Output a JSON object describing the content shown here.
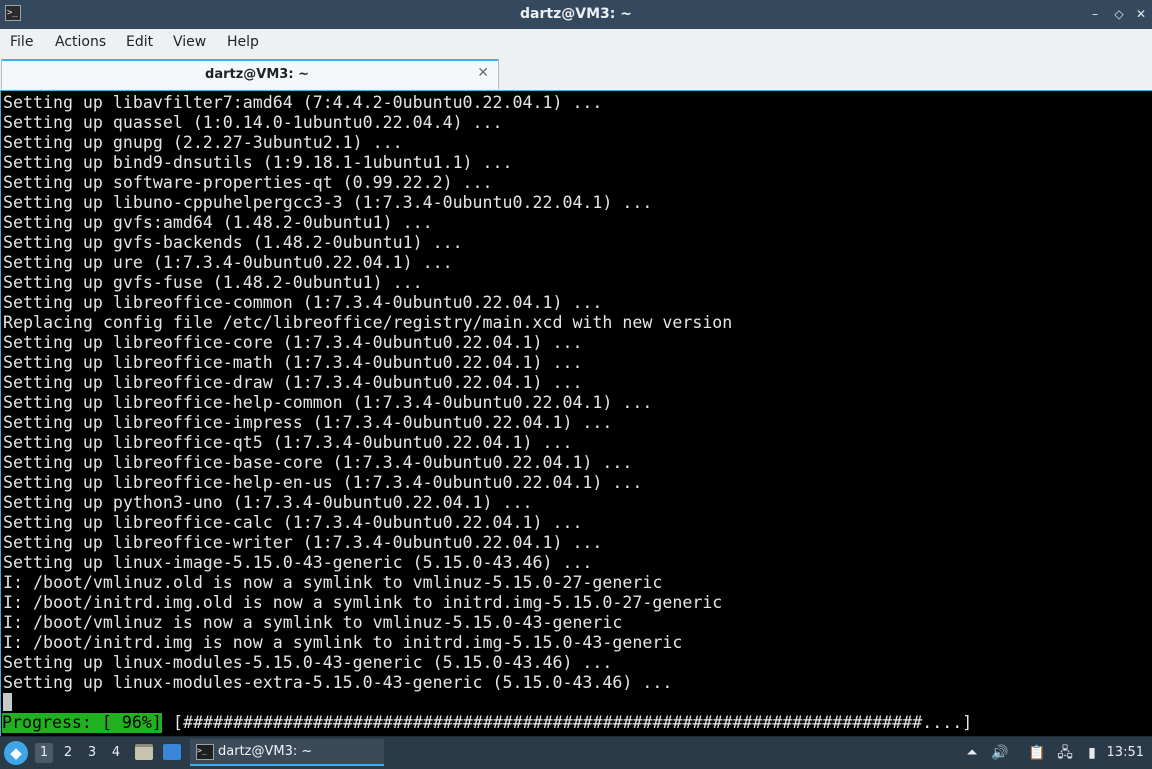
{
  "window": {
    "title": "dartz@VM3: ~",
    "minimize_glyph": "–",
    "restore_glyph": "◇",
    "close_glyph": "✕"
  },
  "menu": [
    "File",
    "Actions",
    "Edit",
    "View",
    "Help"
  ],
  "tab": {
    "label": "dartz@VM3: ~",
    "close_glyph": "✕"
  },
  "terminal": {
    "lines": [
      "Setting up libavfilter7:amd64 (7:4.4.2-0ubuntu0.22.04.1) ...",
      "Setting up quassel (1:0.14.0-1ubuntu0.22.04.4) ...",
      "Setting up gnupg (2.2.27-3ubuntu2.1) ...",
      "Setting up bind9-dnsutils (1:9.18.1-1ubuntu1.1) ...",
      "Setting up software-properties-qt (0.99.22.2) ...",
      "Setting up libuno-cppuhelpergcc3-3 (1:7.3.4-0ubuntu0.22.04.1) ...",
      "Setting up gvfs:amd64 (1.48.2-0ubuntu1) ...",
      "Setting up gvfs-backends (1.48.2-0ubuntu1) ...",
      "Setting up ure (1:7.3.4-0ubuntu0.22.04.1) ...",
      "Setting up gvfs-fuse (1.48.2-0ubuntu1) ...",
      "Setting up libreoffice-common (1:7.3.4-0ubuntu0.22.04.1) ...",
      "Replacing config file /etc/libreoffice/registry/main.xcd with new version",
      "Setting up libreoffice-core (1:7.3.4-0ubuntu0.22.04.1) ...",
      "Setting up libreoffice-math (1:7.3.4-0ubuntu0.22.04.1) ...",
      "Setting up libreoffice-draw (1:7.3.4-0ubuntu0.22.04.1) ...",
      "Setting up libreoffice-help-common (1:7.3.4-0ubuntu0.22.04.1) ...",
      "Setting up libreoffice-impress (1:7.3.4-0ubuntu0.22.04.1) ...",
      "Setting up libreoffice-qt5 (1:7.3.4-0ubuntu0.22.04.1) ...",
      "Setting up libreoffice-base-core (1:7.3.4-0ubuntu0.22.04.1) ...",
      "Setting up libreoffice-help-en-us (1:7.3.4-0ubuntu0.22.04.1) ...",
      "Setting up python3-uno (1:7.3.4-0ubuntu0.22.04.1) ...",
      "Setting up libreoffice-calc (1:7.3.4-0ubuntu0.22.04.1) ...",
      "Setting up libreoffice-writer (1:7.3.4-0ubuntu0.22.04.1) ...",
      "Setting up linux-image-5.15.0-43-generic (5.15.0-43.46) ...",
      "I: /boot/vmlinuz.old is now a symlink to vmlinuz-5.15.0-27-generic",
      "I: /boot/initrd.img.old is now a symlink to initrd.img-5.15.0-27-generic",
      "I: /boot/vmlinuz is now a symlink to vmlinuz-5.15.0-43-generic",
      "I: /boot/initrd.img is now a symlink to initrd.img-5.15.0-43-generic",
      "Setting up linux-modules-5.15.0-43-generic (5.15.0-43.46) ...",
      "Setting up linux-modules-extra-5.15.0-43-generic (5.15.0-43.46) ..."
    ],
    "progress_label": "Progress: [ 96%]",
    "progress_bar": "[##########################################################################....]",
    "progress_value": 0.96
  },
  "taskbar": {
    "workspaces": [
      "1",
      "2",
      "3",
      "4"
    ],
    "active_workspace": "1",
    "task_label": "dartz@VM3: ~",
    "clock": "13:51"
  },
  "colors": {
    "titlebar": "#34495e",
    "accent": "#3daee9",
    "progress_green": "#21b020",
    "terminal_bg": "#000000"
  }
}
